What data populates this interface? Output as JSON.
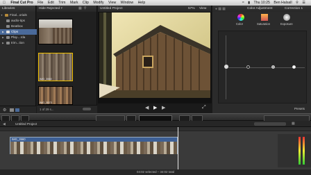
{
  "menubar": {
    "app_name": "Final Cut Pro",
    "items": [
      "File",
      "Edit",
      "Trim",
      "Mark",
      "Clip",
      "Modify",
      "View",
      "Window",
      "Help"
    ],
    "clock": "Thu 10:25",
    "user": "Ben Halsall"
  },
  "libraries": {
    "title": "Libraries",
    "items": [
      {
        "label": "Final...orials",
        "selected": false
      },
      {
        "label": "audio-tips",
        "selected": false
      },
      {
        "label": "Beatbox",
        "selected": false
      },
      {
        "label": "Clips",
        "selected": true
      },
      {
        "label": "Play....rda",
        "selected": false
      },
      {
        "label": "trim...tion",
        "selected": false
      }
    ]
  },
  "browser": {
    "filter": "Hide Rejected",
    "clips": [
      {
        "label": ""
      },
      {
        "label": "IMG_3560"
      },
      {
        "label": "IMG_3573"
      }
    ],
    "count": "1 of 29 s..."
  },
  "viewer": {
    "project_name": "Untitled Project",
    "zoom": "57%",
    "view_menu": "View"
  },
  "inspector": {
    "title": "Color Adjustment",
    "correction": "Correction 1",
    "tabs": [
      "Color",
      "Saturation",
      "Exposure"
    ],
    "preset": "Presets"
  },
  "timeline": {
    "project_name": "Untitled Project",
    "clip_label": "IMG_3560",
    "status": "04:02 selected – 34:02 total"
  },
  "colors": {
    "selection_blue": "#4a6a9a",
    "clip_blue": "#3d5f94",
    "playhead": "#e8e8e8"
  }
}
